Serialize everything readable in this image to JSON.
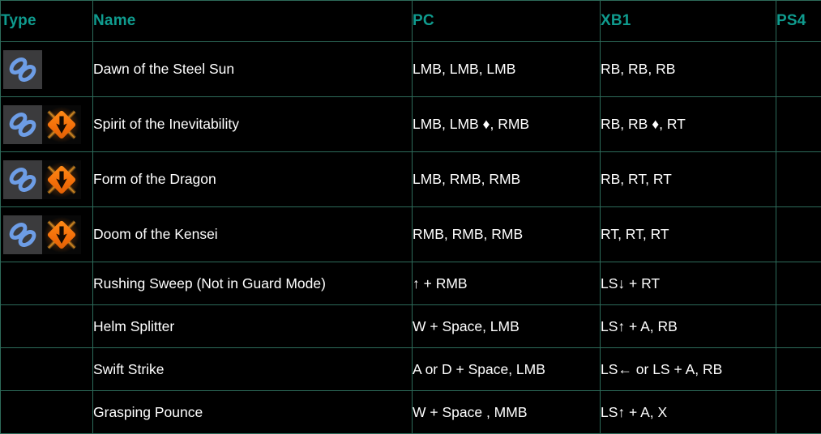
{
  "table": {
    "columns": [
      {
        "key": "type",
        "label": "Type"
      },
      {
        "key": "name",
        "label": "Name"
      },
      {
        "key": "pc",
        "label": "PC"
      },
      {
        "key": "xb1",
        "label": "XB1"
      },
      {
        "key": "ps4",
        "label": "PS4"
      }
    ],
    "rows": [
      {
        "icons": [
          "chain-link-icon"
        ],
        "name": "Dawn of the Steel Sun",
        "pc": "LMB, LMB, LMB",
        "xb1": "RB, RB, RB",
        "ps4": ""
      },
      {
        "icons": [
          "chain-link-icon",
          "unblockable-attack-icon"
        ],
        "name": "Spirit of the Inevitability",
        "pc": "LMB, LMB ♦, RMB",
        "xb1": "RB, RB ♦, RT",
        "ps4": ""
      },
      {
        "icons": [
          "chain-link-icon",
          "unblockable-attack-icon"
        ],
        "name": "Form of the Dragon",
        "pc": "LMB, RMB, RMB",
        "xb1": "RB, RT, RT",
        "ps4": ""
      },
      {
        "icons": [
          "chain-link-icon",
          "unblockable-attack-icon"
        ],
        "name": "Doom of the Kensei",
        "pc": "RMB, RMB, RMB",
        "xb1": "RT, RT, RT",
        "ps4": ""
      },
      {
        "icons": [],
        "name": "Rushing Sweep (Not in Guard Mode)",
        "pc": "↑ + RMB",
        "xb1": "LS↓ + RT",
        "ps4": ""
      },
      {
        "icons": [],
        "name": "Helm Splitter",
        "pc": "W + Space, LMB",
        "xb1": "LS↑ + A, RB",
        "ps4": ""
      },
      {
        "icons": [],
        "name": "Swift Strike",
        "pc": "A or D + Space, LMB",
        "xb1": "LS← or LS + A, RB",
        "ps4": ""
      },
      {
        "icons": [],
        "name": "Grasping Pounce",
        "pc": "W + Space , MMB",
        "xb1": "LS↑ + A, X",
        "ps4": ""
      }
    ]
  },
  "colors": {
    "background": "#000000",
    "border": "#2d6b5a",
    "header_text": "#0f9b8e",
    "body_text": "#ffffff",
    "chain_icon": "#6d9de6",
    "unblockable_icon": "#f4700a"
  }
}
